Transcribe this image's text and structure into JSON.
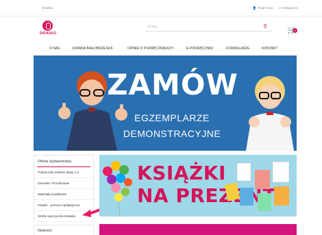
{
  "topbar": {
    "left": "Didasko",
    "right": [
      "Moje konto",
      "Wyloguj się"
    ]
  },
  "logo": {
    "text": "DIDASKO"
  },
  "search": {
    "placeholder": "Szukaj..."
  },
  "cart": {
    "count": "0"
  },
  "nav": [
    "O NAS",
    "JOANNA BIAŁOBRZESKA",
    "OPINIE O PODRĘCZNIKACH",
    "E-PODRĘCZNIKI",
    "FORMULARZE",
    "KONTAKT"
  ],
  "hero": {
    "title": "ZAMÓW",
    "line1": "EGZEMPLARZE",
    "line2": "DEMONSTRACYJNE"
  },
  "sidebar": {
    "heading": "Oferta wydawnictwa",
    "items": [
      "Podręczniki szkolne klasy 1-3",
      "Zerówka i Przedszkole",
      "Materiały dodatkowe",
      "Książki - pomoce dydaktyczne",
      "Strefa nauczyciela Didasko"
    ]
  },
  "news": {
    "heading": "Nowości"
  },
  "promo": {
    "line1": "KSIĄŻKI",
    "line2": "NA PREZENT"
  },
  "colors": {
    "accent": "#d4145a",
    "hero_bg": "#2a6fb0",
    "promo_bg": "#9fd8e8"
  }
}
